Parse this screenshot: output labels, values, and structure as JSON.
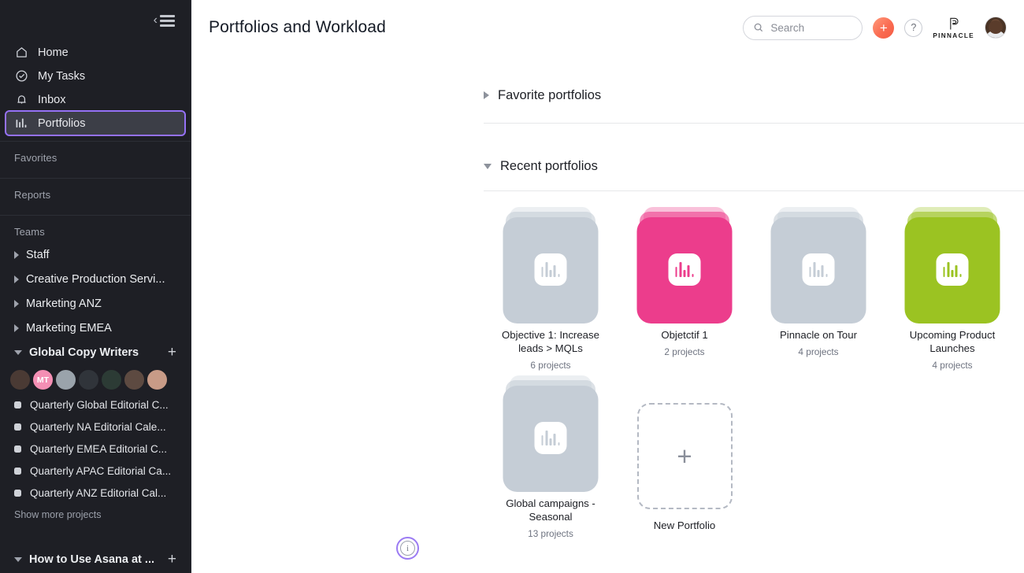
{
  "sidebar": {
    "collapse_label": "Collapse sidebar",
    "nav": [
      {
        "label": "Home",
        "icon": "home-icon"
      },
      {
        "label": "My Tasks",
        "icon": "check-circle-icon"
      },
      {
        "label": "Inbox",
        "icon": "bell-icon"
      },
      {
        "label": "Portfolios",
        "icon": "chart-bars-icon",
        "active": true
      }
    ],
    "favorites_label": "Favorites",
    "reports_label": "Reports",
    "teams_label": "Teams",
    "teams": [
      {
        "label": "Staff",
        "expanded": false
      },
      {
        "label": "Creative Production Servi...",
        "expanded": false
      },
      {
        "label": "Marketing ANZ",
        "expanded": false
      },
      {
        "label": "Marketing EMEA",
        "expanded": false
      },
      {
        "label": "Global Copy Writers",
        "expanded": true,
        "add_label": "+"
      }
    ],
    "members": [
      {
        "initials": "",
        "color": "#3c3230"
      },
      {
        "initials": "MT",
        "color": "#f48fb4"
      },
      {
        "initials": "",
        "color": "#9aa3ab"
      },
      {
        "initials": "",
        "color": "#2f3338"
      },
      {
        "initials": "",
        "color": "#2a3b33"
      },
      {
        "initials": "",
        "color": "#5a4a42"
      },
      {
        "initials": "",
        "color": "#c79a86"
      }
    ],
    "projects": [
      {
        "label": "Quarterly Global Editorial C..."
      },
      {
        "label": "Quarterly NA Editorial Cale..."
      },
      {
        "label": "Quarterly EMEA Editorial C..."
      },
      {
        "label": "Quarterly APAC Editorial Ca..."
      },
      {
        "label": "Quarterly ANZ Editorial Cal..."
      }
    ],
    "show_more_label": "Show more projects",
    "bottom_team": {
      "label": "How to Use Asana at ...",
      "expanded": true,
      "add_label": "+"
    },
    "active_highlight_color": "#9571f6",
    "background_color": "#1e1f25"
  },
  "topbar": {
    "page_title": "Portfolios and Workload",
    "search_placeholder": "Search",
    "add_label": "+",
    "help_label": "?",
    "brand_word": "PINNACLE",
    "add_button_color": "#fa6c52"
  },
  "sections": [
    {
      "title": "Favorite portfolios",
      "expanded": false,
      "cards": []
    },
    {
      "title": "Recent portfolios",
      "expanded": true,
      "view_toggle": "grid-view",
      "cards": [
        {
          "title": "Objective 1: Increase leads > MQLs",
          "projects": "6 projects",
          "color": "#c5cdd6"
        },
        {
          "title": "Objetctif 1",
          "projects": "2 projects",
          "color": "#ec3d8c"
        },
        {
          "title": "Pinnacle on Tour",
          "projects": "4 projects",
          "color": "#c5cdd6"
        },
        {
          "title": "Upcoming Product Launches",
          "projects": "4 projects",
          "color": "#9bc322"
        },
        {
          "title": "Global campaigns - Seasonal",
          "projects": "13 projects",
          "color": "#c5cdd6"
        }
      ],
      "new_card": {
        "label": "New Portfolio",
        "plus": "+"
      }
    }
  ],
  "info_button": {
    "glyph": "i",
    "label": "information",
    "highlight_color": "#9b7bf3"
  }
}
